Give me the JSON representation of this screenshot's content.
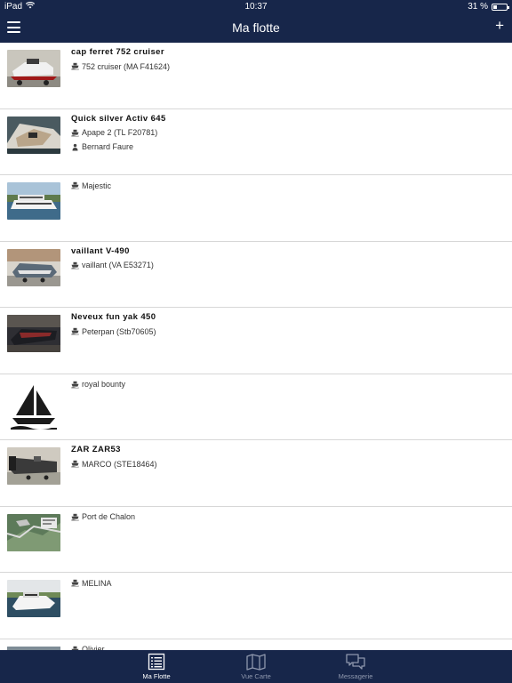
{
  "status_bar": {
    "device": "iPad",
    "time": "10:37",
    "battery": "31 %",
    "battery_fraction": 0.31
  },
  "header": {
    "title": "Ma flotte",
    "add_label": "+"
  },
  "boats": [
    {
      "name": "cap ferret 752 cruiser",
      "lines": [
        {
          "icon": "boat-icon",
          "text": "752 cruiser (MA F41624)"
        }
      ],
      "thumb": "photo-1"
    },
    {
      "name": "Quick silver Activ 645",
      "lines": [
        {
          "icon": "boat-icon",
          "text": "Apape 2 (TL F20781)"
        },
        {
          "icon": "person-icon",
          "text": "Bernard Faure"
        }
      ],
      "thumb": "photo-2"
    },
    {
      "name": "",
      "lines": [
        {
          "icon": "boat-icon",
          "text": "Majestic"
        }
      ],
      "thumb": "photo-3"
    },
    {
      "name": "vaillant V-490",
      "lines": [
        {
          "icon": "boat-icon",
          "text": "vaillant (VA E53271)"
        }
      ],
      "thumb": "photo-4"
    },
    {
      "name": "Neveux fun yak 450",
      "lines": [
        {
          "icon": "boat-icon",
          "text": "Peterpan (Stb70605)"
        }
      ],
      "thumb": "photo-5"
    },
    {
      "name": "",
      "lines": [
        {
          "icon": "boat-icon",
          "text": "royal bounty"
        }
      ],
      "thumb": "sailboat-logo"
    },
    {
      "name": "ZAR ZAR53",
      "lines": [
        {
          "icon": "boat-icon",
          "text": "MARCO (STE18464)"
        }
      ],
      "thumb": "photo-6"
    },
    {
      "name": "",
      "lines": [
        {
          "icon": "boat-icon",
          "text": "Port de Chalon"
        }
      ],
      "thumb": "map-photo"
    },
    {
      "name": "",
      "lines": [
        {
          "icon": "boat-icon",
          "text": "MELINA"
        }
      ],
      "thumb": "photo-7"
    },
    {
      "name": "",
      "lines": [
        {
          "icon": "boat-icon",
          "text": "Olivier"
        }
      ],
      "thumb": "photo-8"
    }
  ],
  "tabs": [
    {
      "label": "Ma Flotte",
      "icon": "list-icon",
      "active": true
    },
    {
      "label": "Vue Carte",
      "icon": "map-icon",
      "active": false
    },
    {
      "label": "Messagerie",
      "icon": "chat-icon",
      "active": false
    }
  ],
  "colors": {
    "bar": "#17264a",
    "tab_inactive": "#8e97ad",
    "divider": "#d7d7d7"
  }
}
